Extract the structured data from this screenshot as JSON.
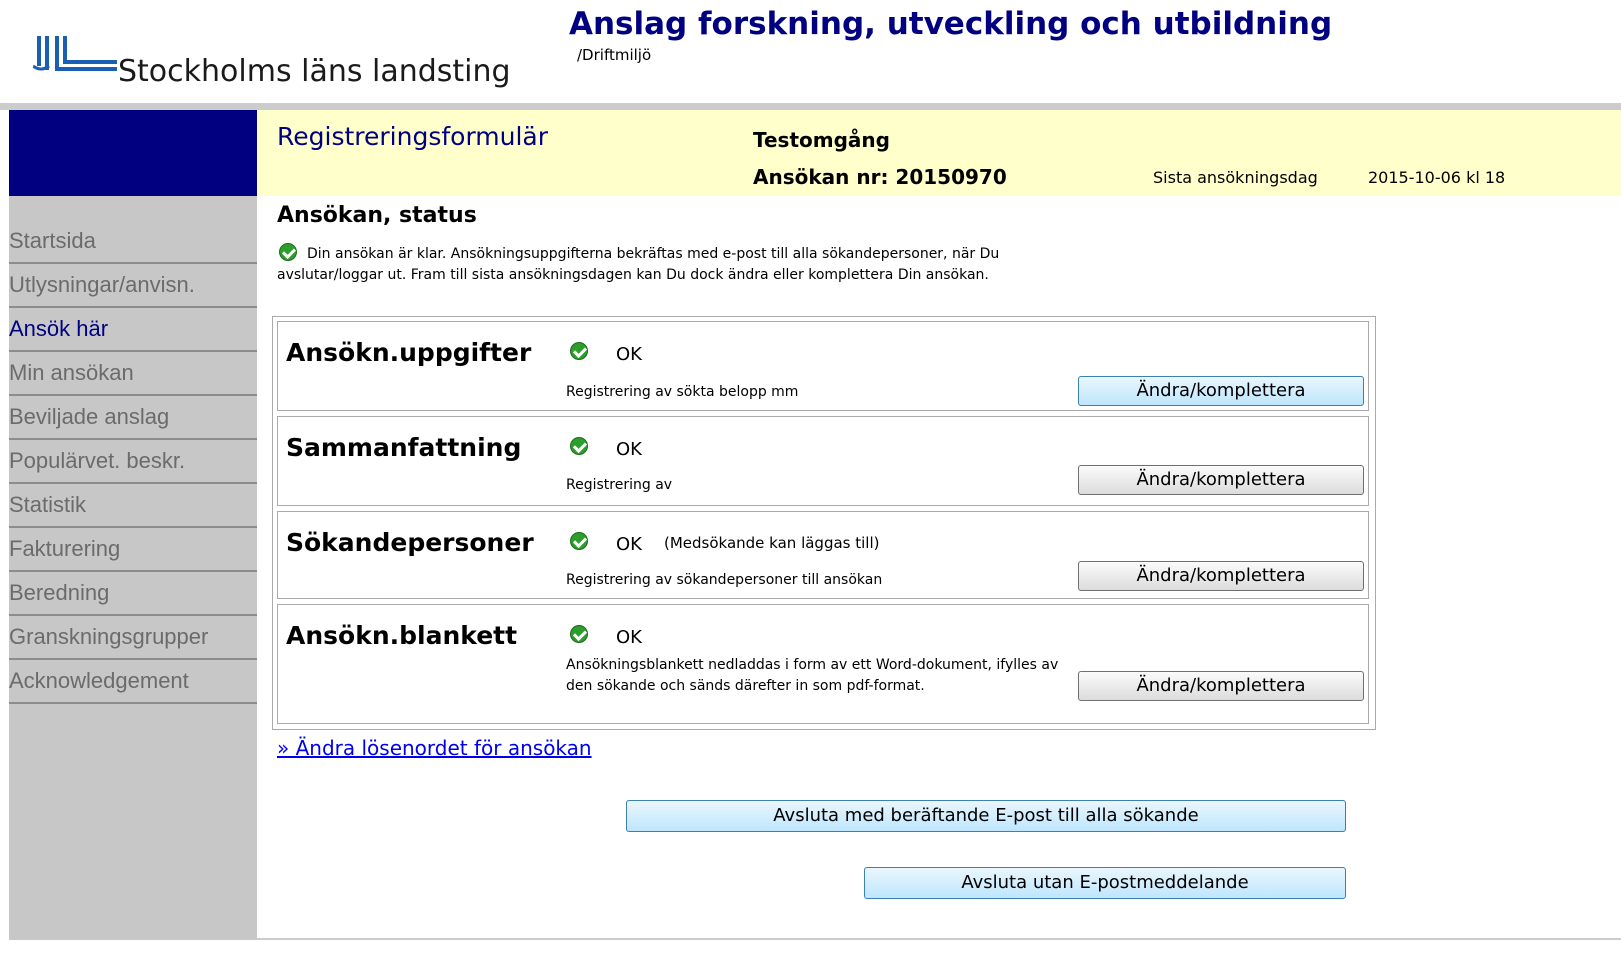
{
  "header": {
    "org_name": "Stockholms läns landsting",
    "app_title": "Anslag forskning, utveckling och utbildning",
    "environment": "/Driftmiljö",
    "brand_color": "#000080"
  },
  "sidebar": {
    "items": [
      {
        "label": "Startsida",
        "active": false
      },
      {
        "label": "Utlysningar/anvisn.",
        "active": false
      },
      {
        "label": "Ansök här",
        "active": true
      },
      {
        "label": "Min ansökan",
        "active": false
      },
      {
        "label": "Beviljade anslag",
        "active": false
      },
      {
        "label": "Populärvet. beskr.",
        "active": false
      },
      {
        "label": "Statistik",
        "active": false
      },
      {
        "label": "Fakturering",
        "active": false
      },
      {
        "label": "Beredning",
        "active": false
      },
      {
        "label": "Granskningsgrupper",
        "active": false
      },
      {
        "label": "Acknowledgement",
        "active": false
      }
    ]
  },
  "form_header": {
    "title": "Registreringsformulär",
    "round": "Testomgång",
    "application_number": "Ansökan nr: 20150970",
    "deadline_label": "Sista ansökningsdag",
    "deadline_value": "2015-10-06 kl 18",
    "background_color": "#ffffcc"
  },
  "status": {
    "heading": "Ansökan, status",
    "icon": "check-circle-icon",
    "message": "Din ansökan är klar. Ansökningsuppgifterna bekräftas med e-post till alla sökandepersoner, när Du avslutar/loggar ut. Fram till sista ansökningsdagen kan Du dock ändra eller komplettera Din ansökan."
  },
  "sections": [
    {
      "title": "Ansökn.uppgifter",
      "status": "OK",
      "note": "",
      "description": "Registrering av sökta belopp mm",
      "button": "Ändra/komplettera"
    },
    {
      "title": "Sammanfattning",
      "status": "OK",
      "note": "",
      "description": "Registrering av",
      "button": "Ändra/komplettera"
    },
    {
      "title": "Sökandepersoner",
      "status": "OK",
      "note": "(Medsökande kan läggas till)",
      "description": "Registrering av sökandepersoner till ansökan",
      "button": "Ändra/komplettera"
    },
    {
      "title": "Ansökn.blankett",
      "status": "OK",
      "note": "",
      "description": "Ansökningsblankett nedladdas i form av ett Word-dokument, ifylles av den sökande och sänds därefter in som pdf-format.",
      "button": "Ändra/komplettera"
    }
  ],
  "links": {
    "change_password": "» Ändra lösenordet för ansökan"
  },
  "actions": {
    "finish_with_email": "Avsluta med beräftande E-post till alla sökande",
    "finish_without_email": "Avsluta utan E-postmeddelande"
  }
}
